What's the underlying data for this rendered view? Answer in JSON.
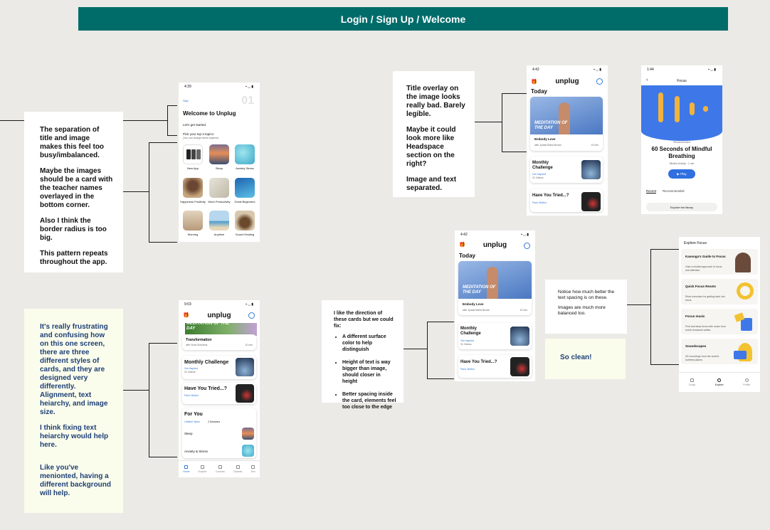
{
  "banner": {
    "title": "Login / Sign Up / Welcome"
  },
  "notes": {
    "separation": [
      "The separation of title and image makes this feel too busy/imbalanced.",
      "Maybe the images should be a card with the teacher names overlayed in the bottom corner.",
      "Also I think the border radius is too big.",
      "This pattern repeats throughout the app."
    ],
    "overlay": [
      "Title overlay on the image looks really bad. Barely legible.",
      "Maybe it could look more like Headspace section on the right?",
      "Image and text separated."
    ],
    "frustrating": [
      "It's really frustrating and confusing how on this one screen, there are three different styles of cards, and they are designed very differently. Alignment, text heiarchy, and image size.",
      "I think fixing text heiarchy would help here.",
      "Like you've menionted, having a different background will help."
    ],
    "direction": {
      "intro": "I like the direction of these cards but we could fix:",
      "bullets": [
        "A different surface color to help distinguish",
        "Height of text is way bigger than image, should closer in height",
        "Better spacing inside the card, elements feel too close to the edge"
      ]
    },
    "notice": [
      "Notice how much better the text spacing is on these.",
      "Images are much more balanced too."
    ],
    "clean": "So clean!"
  },
  "welcome_screen": {
    "time": "4:39",
    "skip": "Skip",
    "step": "01",
    "title": "Welcome to Unplug",
    "subtitle": "Let's get started.",
    "pick": "Pick your top 3 topics:",
    "pick_hint": "(You can change these anytime)",
    "topics": [
      "New App",
      "Sleep",
      "Anxiety Stress",
      "Happiness Positivity",
      "Work Productivity",
      "Great Beginners",
      "Morning",
      "Anytime",
      "Sound Healing"
    ]
  },
  "today_screen": {
    "time": "4:42",
    "logo": "unplug",
    "heading": "Today",
    "hero_title": "MEDITATION OF THE DAY",
    "hero_card_title": "Embody Love",
    "hero_card_teacher": "with Jynael Maria Brown",
    "hero_card_duration": "10 min",
    "card1_title": "Monthly Challenge",
    "card1_sub": "Get Inspired",
    "card1_meta": "31 Videos",
    "card2_title": "Have You Tried...?",
    "card2_sub": "Panic Button"
  },
  "focus_screen": {
    "time": "1:44",
    "title": "Focus",
    "recommended_label": "Recommended",
    "session_title": "60 Seconds of Mindful Breathing",
    "session_meta": "Mindful Activity · 1 min",
    "play": "Play",
    "tab_recent": "Recent",
    "tab_recommended": "Recommended",
    "explore": "Explore the library"
  },
  "explore_screen": {
    "title": "Explore Focus",
    "cards": [
      {
        "title": "Kasonga's Guide to Focus",
        "desc": "Gain a mindful approach to focus and attention."
      },
      {
        "title": "Quick Focus Resets",
        "desc": "Short exercises for getting back into focus."
      },
      {
        "title": "Focus music",
        "desc": "Find and keep focus with music from world-renowned artists."
      },
      {
        "title": "Soundscapes",
        "desc": "3D recordings from the world's loveliest places."
      }
    ],
    "tabs": [
      "Today",
      "Explore",
      "Profile"
    ]
  },
  "home_screen": {
    "time": "9:03",
    "logo": "unplug",
    "hero_title": "MEDITATION OF THE DAY",
    "hero_card_title": "Transformation",
    "hero_card_teacher": "with Scott Schwenk",
    "hero_card_duration": "10 min",
    "card1_title": "Monthly Challenge",
    "card1_sub": "Get Inspired",
    "card1_meta": "31 Videos",
    "card2_title": "Have You Tried...?",
    "card2_sub": "Panic Button",
    "for_you_title": "For You",
    "for_you_meta": "Lifetime Spins",
    "for_you_sessions": "2 Sessions",
    "rows": [
      "Sleep",
      "Anxiety & Stress"
    ],
    "tabs": [
      "Home",
      "Explore",
      "Courses",
      "Classes",
      "Dev"
    ]
  }
}
